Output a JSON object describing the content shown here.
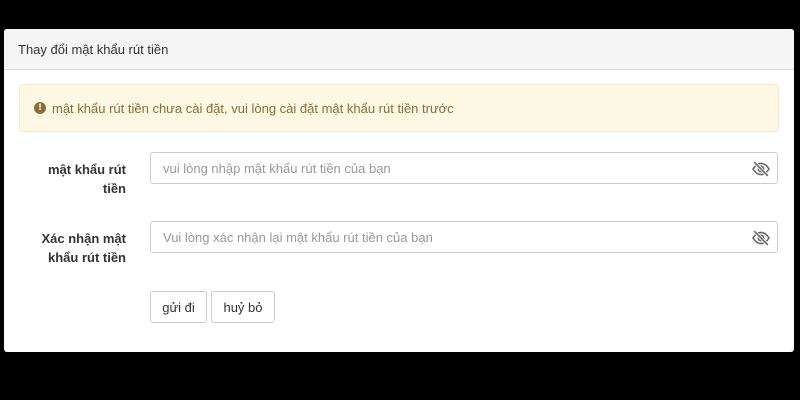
{
  "panel": {
    "title": "Thay đổi mật khẩu rút tiền"
  },
  "alert": {
    "icon": "exclamation-circle-icon",
    "glyph": "!",
    "message": "mật khẩu rút tiền chưa cài đặt, vui lòng cài đặt mật khẩu rút tiền trước",
    "color": "#8a6d3b",
    "background": "#fcf8e3"
  },
  "form": {
    "password": {
      "label_line1": "mật khẩu rút",
      "label_line2": "tiền",
      "placeholder": "vui lòng nhập mật khẩu rút tiền của bạn",
      "value": "",
      "toggle_icon": "eye-slash-icon"
    },
    "confirm": {
      "label_line1": "Xác nhận mật",
      "label_line2": "khẩu rút tiền",
      "placeholder": "Vui lòng xác nhận lại mật khẩu rút tiền của bạn",
      "value": "",
      "toggle_icon": "eye-slash-icon"
    }
  },
  "buttons": {
    "submit_label": "gửi đi",
    "cancel_label": "huỷ bỏ"
  }
}
